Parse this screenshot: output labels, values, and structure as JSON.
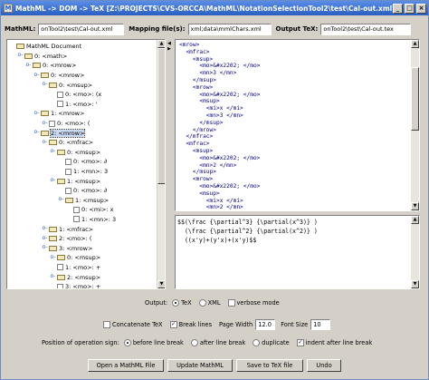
{
  "window": {
    "title": "MathML -> DOM -> TeX [Z:\\PROJECTS\\CVS-ORCCA\\MathML\\NotationSelectionTool2\\test\\Cal-out.xml]",
    "minimize_glyph": "_",
    "maximize_glyph": "□",
    "close_glyph": "×",
    "icon_glyph": "M"
  },
  "files": {
    "mathml_label": "MathML:",
    "mathml_value": "onTool2\\test\\Cal-out.xml",
    "mapping_label": "Mapping file(s):",
    "mapping_value": "xml;data\\mmlChars.xml",
    "output_label": "Output TeX:",
    "output_value": "onTool2\\test\\Cal-out.tex"
  },
  "tree": {
    "rows": [
      {
        "toggle": "",
        "icon": "folder",
        "label": "MathML Document"
      },
      {
        "toggle": "o-",
        "icon": "folder",
        "label": "0: <math>"
      },
      {
        "toggle": "o-",
        "icon": "folder",
        "label": "0: <mrow>"
      },
      {
        "toggle": "o-",
        "icon": "folder",
        "label": "0: <mrow>"
      },
      {
        "toggle": "o-",
        "icon": "folder",
        "label": "0: <msup>"
      },
      {
        "toggle": "",
        "icon": "file",
        "label": "0: <mo>: (x"
      },
      {
        "toggle": "",
        "icon": "file",
        "label": "1: <mo>: '"
      },
      {
        "toggle": "o-",
        "icon": "folder",
        "label": "1: <mrow>"
      },
      {
        "toggle": "o-",
        "icon": "file",
        "label": "0: <mo>: ("
      },
      {
        "toggle": "o-",
        "icon": "folder",
        "label": "2: <mrow>",
        "selected": true
      },
      {
        "toggle": "o-",
        "icon": "folder",
        "label": "0: <mfrac>"
      },
      {
        "toggle": "o-",
        "icon": "folder",
        "label": "0: <msup>"
      },
      {
        "toggle": "",
        "icon": "file",
        "label": "0: <mo>: ∂"
      },
      {
        "toggle": "",
        "icon": "file",
        "label": "1: <mn>: 3"
      },
      {
        "toggle": "o-",
        "icon": "folder",
        "label": "1: <msup>"
      },
      {
        "toggle": "",
        "icon": "file",
        "label": "0: <mo>: ∂"
      },
      {
        "toggle": "o-",
        "icon": "folder",
        "label": "1: <msup>"
      },
      {
        "toggle": "",
        "icon": "file",
        "label": "0: <mi>: x"
      },
      {
        "toggle": "",
        "icon": "file",
        "label": "1: <mn>: 3"
      },
      {
        "toggle": "o-",
        "icon": "folder",
        "label": "1: <mfrac>"
      },
      {
        "toggle": "o-",
        "icon": "folder",
        "label": "2: <mo>: ("
      },
      {
        "toggle": "o-",
        "icon": "folder",
        "label": "3: <mrow>"
      },
      {
        "toggle": "o-",
        "icon": "folder",
        "label": "0: <msup>"
      },
      {
        "toggle": "",
        "icon": "file",
        "label": "1: <mo>: +"
      },
      {
        "toggle": "o-",
        "icon": "folder",
        "label": "2: <msup>"
      },
      {
        "toggle": "",
        "icon": "file",
        "label": "3: <mo>: +"
      }
    ]
  },
  "xml_view": {
    "lines": [
      "<mrow>",
      "  <mfrac>",
      "    <msup>",
      "      <mo>&#x2202; </mo>",
      "      <mn>3 </mn>",
      "    </msup>",
      "    <mrow>",
      "      <mo>&#x2202; </mo>",
      "      <msup>",
      "        <mi>x </mi>",
      "        <mn>3 </mn>",
      "      </msup>",
      "    </mrow>",
      "  </mfrac>",
      "  <mfrac>",
      "    <msup>",
      "      <mo>&#x2202; </mo>",
      "      <mn>2 </mn>",
      "    </msup>",
      "    <mrow>",
      "      <mo>&#x2202; </mo>",
      "      <msup>",
      "        <mi>x </mi>",
      "        <mn>2 </mn>"
    ]
  },
  "tex_view": {
    "lines": [
      "$$(\\frac {\\partial^3} {\\partial(x^3)} )",
      "  (\\frac {\\partial^2} {\\partial(x^2)} )",
      "  ((x'y)+(y'x)+(x'y)$$"
    ]
  },
  "options": {
    "output_label": "Output:",
    "tex_label": "TeX",
    "xml_label": "XML",
    "verbose_label": "verbose mode",
    "concatenate_label": "Concatenate TeX",
    "break_lines_label": "Break lines",
    "page_width_label": "Page Width",
    "page_width_value": "12.0",
    "font_size_label": "Font Size",
    "font_size_value": "10",
    "position_label": "Position of operation sign:",
    "before_label": "before line break",
    "after_label": "after line break",
    "duplicate_label": "duplicate",
    "indent_label": "indent after line break",
    "check_mark": "✓"
  },
  "buttons": {
    "open_label": "Open a MathML File",
    "update_label": "Update MathML",
    "save_label": "Save to TeX file",
    "undo_label": "Undo"
  },
  "scroll": {
    "up_glyph": "▲",
    "down_glyph": "▼",
    "split_left_glyph": "◀",
    "split_right_glyph": "▶"
  }
}
